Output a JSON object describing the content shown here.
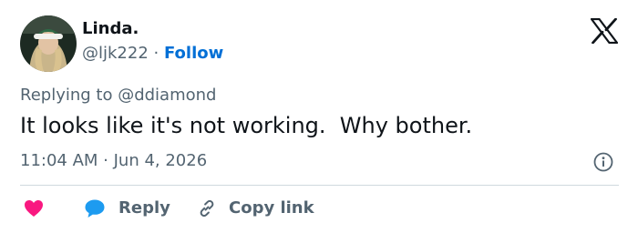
{
  "header": {
    "display_name": "Linda.",
    "handle": "@ljk222",
    "separator": " · ",
    "follow_label": "Follow",
    "logo_icon": "x-logo-icon"
  },
  "tweet": {
    "replying_prefix": "Replying to ",
    "replying_to": "@ddiamond",
    "text": "It looks like it's not working.  Why bother.",
    "timestamp": "11:04 AM · Jun 4, 2026",
    "info_icon": "info-icon"
  },
  "actions": {
    "like_icon": "heart-icon",
    "reply_icon": "speech-bubble-icon",
    "reply_label": "Reply",
    "copy_icon": "link-icon",
    "copy_label": "Copy link"
  },
  "colors": {
    "link_blue": "#006fd6",
    "muted_text": "#536471",
    "heart_pink": "#f91880",
    "bubble_blue": "#1d9bf0",
    "divider": "#cfd9de",
    "text": "#0f1419"
  }
}
